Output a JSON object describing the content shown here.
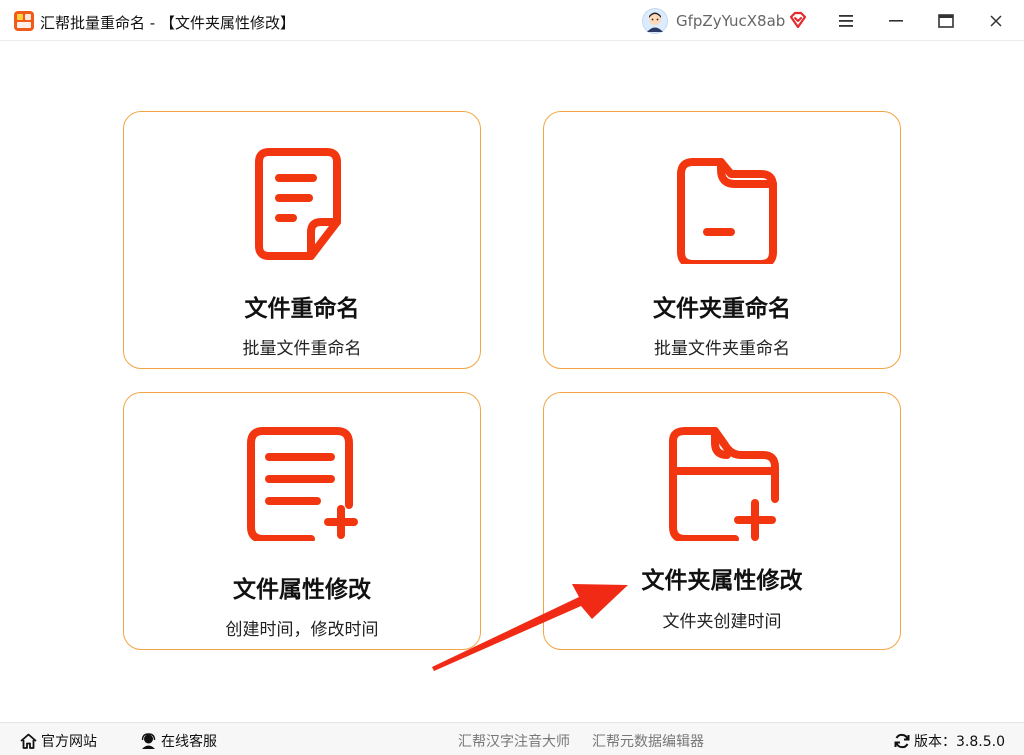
{
  "window": {
    "title": "汇帮批量重命名 - 【文件夹属性修改】",
    "username": "GfpZyYucX8ab"
  },
  "colors": {
    "accent": "#f2360f",
    "card_border": "#f3a545",
    "arrow": "#f02a14"
  },
  "cards": [
    {
      "title": "文件重命名",
      "subtitle": "批量文件重命名",
      "icon": "document-icon"
    },
    {
      "title": "文件夹重命名",
      "subtitle": "批量文件夹重命名",
      "icon": "folder-icon"
    },
    {
      "title": "文件属性修改",
      "subtitle": "创建时间，修改时间",
      "icon": "document-add-icon"
    },
    {
      "title": "文件夹属性修改",
      "subtitle": "文件夹创建时间",
      "icon": "folder-add-icon"
    }
  ],
  "footer": {
    "website": "官方网站",
    "service": "在线客服",
    "link1": "汇帮汉字注音大师",
    "link2": "汇帮元数据编辑器",
    "version": "版本：3.8.5.0"
  }
}
